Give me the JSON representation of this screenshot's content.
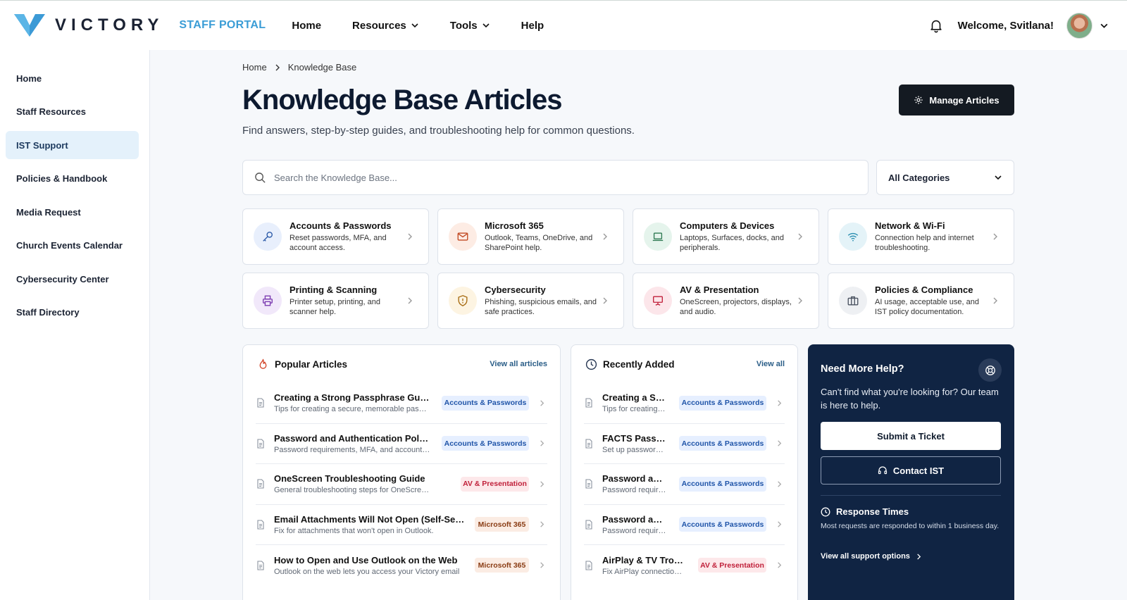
{
  "header": {
    "logo_text": "VICTORY",
    "portal_label": "STAFF PORTAL",
    "nav": [
      {
        "label": "Home"
      },
      {
        "label": "Resources"
      },
      {
        "label": "Tools"
      },
      {
        "label": "Help"
      }
    ],
    "welcome": "Welcome, Svitlana!"
  },
  "sidebar": {
    "items": [
      {
        "label": "Home"
      },
      {
        "label": "Staff Resources"
      },
      {
        "label": "IST Support",
        "active": true
      },
      {
        "label": "Policies & Handbook"
      },
      {
        "label": "Media Request"
      },
      {
        "label": "Church Events Calendar"
      },
      {
        "label": "Cybersecurity Center"
      },
      {
        "label": "Staff Directory"
      }
    ]
  },
  "breadcrumb": {
    "home": "Home",
    "current": "Knowledge Base"
  },
  "page": {
    "title": "Knowledge Base Articles",
    "subtitle": "Find answers, step-by-step guides, and troubleshooting help for common questions.",
    "manage_label": "Manage Articles"
  },
  "search": {
    "placeholder": "Search the Knowledge Base...",
    "category_value": "All Categories"
  },
  "categories": [
    {
      "title": "Accounts & Passwords",
      "desc": "Reset passwords, MFA, and account access.",
      "icon": "key-icon"
    },
    {
      "title": "Microsoft 365",
      "desc": "Outlook, Teams, OneDrive, and SharePoint help.",
      "icon": "mail-icon"
    },
    {
      "title": "Computers & Devices",
      "desc": "Laptops, Surfaces, docks, and peripherals.",
      "icon": "laptop-icon"
    },
    {
      "title": "Network & Wi-Fi",
      "desc": "Connection help and internet troubleshooting.",
      "icon": "wifi-icon"
    },
    {
      "title": "Printing & Scanning",
      "desc": "Printer setup, printing, and scanner help.",
      "icon": "printer-icon"
    },
    {
      "title": "Cybersecurity",
      "desc": "Phishing, suspicious emails, and safe practices.",
      "icon": "shield-icon"
    },
    {
      "title": "AV & Presentation",
      "desc": "OneScreen, projectors, displays, and audio.",
      "icon": "presentation-icon"
    },
    {
      "title": "Policies & Compliance",
      "desc": "AI usage, acceptable use, and IST policy documentation.",
      "icon": "briefcase-icon"
    }
  ],
  "popular": {
    "title": "Popular Articles",
    "link": "View all articles",
    "rows": [
      {
        "title": "Creating a Strong Passphrase Guide",
        "desc": "Tips for creating a secure, memorable passphrase",
        "badge": "Accounts & Passwords"
      },
      {
        "title": "Password and Authentication Policy",
        "desc": "Password requirements, MFA, and account security",
        "badge": "Accounts & Passwords"
      },
      {
        "title": "OneScreen Troubleshooting Guide",
        "desc": "General troubleshooting steps for OneScreen displays",
        "badge": "AV & Presentation"
      },
      {
        "title": "Email Attachments Will Not Open (Self-Service)",
        "desc": "Fix for attachments that won't open in Outlook.",
        "badge": "Microsoft 365"
      },
      {
        "title": "How to Open and Use Outlook on the Web",
        "desc": "Outlook on the web lets you access your Victory email",
        "badge": "Microsoft 365"
      }
    ]
  },
  "recent": {
    "title": "Recently Added",
    "link": "View all",
    "rows": [
      {
        "title": "Creating a Strong Passphrase Guide",
        "desc": "Tips for creating a secure passphrase",
        "badge": "Accounts & Passwords"
      },
      {
        "title": "FACTS Passkey Setup",
        "desc": "Set up passwordless sign-in",
        "badge": "Accounts & Passwords"
      },
      {
        "title": "Password and Authentication Policy",
        "desc": "Password requirements",
        "badge": "Accounts & Passwords"
      },
      {
        "title": "Password and Authentication Policy",
        "desc": "Password requirements",
        "badge": "Accounts & Passwords"
      },
      {
        "title": "AirPlay & TV Troubleshooting",
        "desc": "Fix AirPlay connection issues",
        "badge": "AV & Presentation"
      }
    ]
  },
  "help": {
    "title": "Need More Help?",
    "desc": "Can't find what you're looking for? Our team is here to help.",
    "ticket": "Submit a Ticket",
    "contact": "Contact IST",
    "resp_title": "Response Times",
    "resp_desc": "Most requests are responded to within 1 business day.",
    "link": "View all support options"
  },
  "colors": {
    "accent": "#3b9dd6",
    "navy": "#102443",
    "dark_button": "#141a22"
  }
}
